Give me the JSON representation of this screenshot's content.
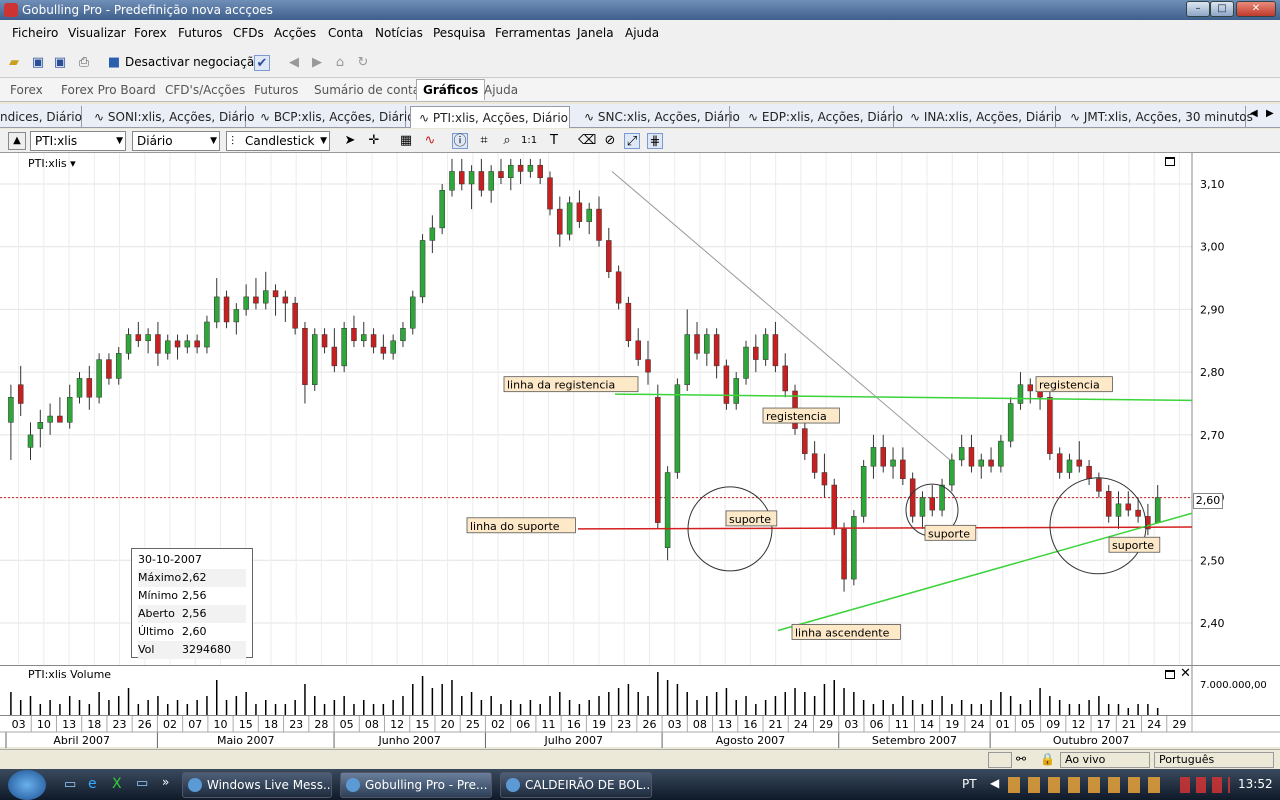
{
  "window": {
    "title": "Gobulling Pro - Predefinição nova accçoes"
  },
  "menu": [
    "Ficheiro",
    "Visualizar",
    "Forex",
    "Futuros",
    "CFDs",
    "Acções",
    "Conta",
    "Notícias",
    "Pesquisa",
    "Ferramentas",
    "Janela",
    "Ajuda"
  ],
  "toolbar": {
    "trading_toggle": "Desactivar negociação"
  },
  "main_tabs": [
    {
      "label": "Forex"
    },
    {
      "label": "Forex Pro Board"
    },
    {
      "label": "CFD's/Acções"
    },
    {
      "label": "Futuros"
    },
    {
      "label": "Sumário de conta"
    },
    {
      "label": "Gráficos",
      "active": true
    },
    {
      "label": "Ajuda"
    }
  ],
  "chart_tabs": [
    {
      "label": "ndices, Diário"
    },
    {
      "label": "SONI:xlis, Acções, Diário"
    },
    {
      "label": "BCP:xlis, Acções, Diário"
    },
    {
      "label": "PTI:xlis, Acções, Diário",
      "active": true
    },
    {
      "label": "SNC:xlis, Acções, Diário"
    },
    {
      "label": "EDP:xlis, Acções, Diário"
    },
    {
      "label": "INA:xlis, Acções, Diário"
    },
    {
      "label": "JMT:xlis, Acções, 30 minutos"
    }
  ],
  "chart_toolbar": {
    "symbol": "PTI:xlis",
    "period": "Diário",
    "style": "Candlestick"
  },
  "chart_data": {
    "type": "candlestick",
    "title": "PTI:xlis",
    "ylim": [
      2.35,
      3.15
    ],
    "y_ticks": [
      "3,10",
      "3,00",
      "2,90",
      "2,80",
      "2,70",
      "2,60",
      "2,50",
      "2,40"
    ],
    "current_price_label": "2,60",
    "candles": [
      {
        "o": 2.72,
        "h": 2.78,
        "l": 2.66,
        "c": 2.76
      },
      {
        "o": 2.78,
        "h": 2.81,
        "l": 2.73,
        "c": 2.75
      },
      {
        "o": 2.68,
        "h": 2.72,
        "l": 2.66,
        "c": 2.7
      },
      {
        "o": 2.71,
        "h": 2.74,
        "l": 2.68,
        "c": 2.72
      },
      {
        "o": 2.72,
        "h": 2.75,
        "l": 2.7,
        "c": 2.73
      },
      {
        "o": 2.73,
        "h": 2.76,
        "l": 2.72,
        "c": 2.72
      },
      {
        "o": 2.72,
        "h": 2.78,
        "l": 2.71,
        "c": 2.76
      },
      {
        "o": 2.76,
        "h": 2.8,
        "l": 2.75,
        "c": 2.79
      },
      {
        "o": 2.79,
        "h": 2.81,
        "l": 2.74,
        "c": 2.76
      },
      {
        "o": 2.76,
        "h": 2.83,
        "l": 2.75,
        "c": 2.82
      },
      {
        "o": 2.82,
        "h": 2.83,
        "l": 2.78,
        "c": 2.79
      },
      {
        "o": 2.79,
        "h": 2.84,
        "l": 2.78,
        "c": 2.83
      },
      {
        "o": 2.83,
        "h": 2.87,
        "l": 2.82,
        "c": 2.86
      },
      {
        "o": 2.86,
        "h": 2.88,
        "l": 2.84,
        "c": 2.85
      },
      {
        "o": 2.85,
        "h": 2.87,
        "l": 2.83,
        "c": 2.86
      },
      {
        "o": 2.86,
        "h": 2.88,
        "l": 2.81,
        "c": 2.83
      },
      {
        "o": 2.83,
        "h": 2.86,
        "l": 2.82,
        "c": 2.85
      },
      {
        "o": 2.85,
        "h": 2.86,
        "l": 2.82,
        "c": 2.84
      },
      {
        "o": 2.84,
        "h": 2.86,
        "l": 2.83,
        "c": 2.85
      },
      {
        "o": 2.85,
        "h": 2.86,
        "l": 2.83,
        "c": 2.84
      },
      {
        "o": 2.84,
        "h": 2.89,
        "l": 2.83,
        "c": 2.88
      },
      {
        "o": 2.88,
        "h": 2.95,
        "l": 2.87,
        "c": 2.92
      },
      {
        "o": 2.92,
        "h": 2.93,
        "l": 2.87,
        "c": 2.88
      },
      {
        "o": 2.88,
        "h": 2.91,
        "l": 2.86,
        "c": 2.9
      },
      {
        "o": 2.9,
        "h": 2.94,
        "l": 2.89,
        "c": 2.92
      },
      {
        "o": 2.92,
        "h": 2.95,
        "l": 2.9,
        "c": 2.91
      },
      {
        "o": 2.91,
        "h": 2.96,
        "l": 2.9,
        "c": 2.93
      },
      {
        "o": 2.93,
        "h": 2.94,
        "l": 2.89,
        "c": 2.92
      },
      {
        "o": 2.92,
        "h": 2.93,
        "l": 2.88,
        "c": 2.91
      },
      {
        "o": 2.91,
        "h": 2.92,
        "l": 2.86,
        "c": 2.87
      },
      {
        "o": 2.87,
        "h": 2.88,
        "l": 2.75,
        "c": 2.78
      },
      {
        "o": 2.78,
        "h": 2.87,
        "l": 2.77,
        "c": 2.86
      },
      {
        "o": 2.86,
        "h": 2.87,
        "l": 2.83,
        "c": 2.84
      },
      {
        "o": 2.84,
        "h": 2.87,
        "l": 2.8,
        "c": 2.81
      },
      {
        "o": 2.81,
        "h": 2.88,
        "l": 2.8,
        "c": 2.87
      },
      {
        "o": 2.87,
        "h": 2.89,
        "l": 2.84,
        "c": 2.85
      },
      {
        "o": 2.85,
        "h": 2.88,
        "l": 2.84,
        "c": 2.86
      },
      {
        "o": 2.86,
        "h": 2.87,
        "l": 2.83,
        "c": 2.84
      },
      {
        "o": 2.84,
        "h": 2.86,
        "l": 2.82,
        "c": 2.83
      },
      {
        "o": 2.83,
        "h": 2.86,
        "l": 2.82,
        "c": 2.85
      },
      {
        "o": 2.85,
        "h": 2.88,
        "l": 2.84,
        "c": 2.87
      },
      {
        "o": 2.87,
        "h": 2.93,
        "l": 2.86,
        "c": 2.92
      },
      {
        "o": 2.92,
        "h": 3.02,
        "l": 2.91,
        "c": 3.01
      },
      {
        "o": 3.01,
        "h": 3.05,
        "l": 2.99,
        "c": 3.03
      },
      {
        "o": 3.03,
        "h": 3.1,
        "l": 3.02,
        "c": 3.09
      },
      {
        "o": 3.09,
        "h": 3.14,
        "l": 3.08,
        "c": 3.12
      },
      {
        "o": 3.12,
        "h": 3.14,
        "l": 3.09,
        "c": 3.1
      },
      {
        "o": 3.1,
        "h": 3.13,
        "l": 3.06,
        "c": 3.12
      },
      {
        "o": 3.12,
        "h": 3.14,
        "l": 3.08,
        "c": 3.09
      },
      {
        "o": 3.09,
        "h": 3.13,
        "l": 3.07,
        "c": 3.12
      },
      {
        "o": 3.12,
        "h": 3.14,
        "l": 3.1,
        "c": 3.11
      },
      {
        "o": 3.11,
        "h": 3.14,
        "l": 3.09,
        "c": 3.13
      },
      {
        "o": 3.13,
        "h": 3.14,
        "l": 3.1,
        "c": 3.12
      },
      {
        "o": 3.12,
        "h": 3.14,
        "l": 3.11,
        "c": 3.13
      },
      {
        "o": 3.13,
        "h": 3.14,
        "l": 3.1,
        "c": 3.11
      },
      {
        "o": 3.11,
        "h": 3.12,
        "l": 3.05,
        "c": 3.06
      },
      {
        "o": 3.06,
        "h": 3.08,
        "l": 3.0,
        "c": 3.02
      },
      {
        "o": 3.02,
        "h": 3.08,
        "l": 3.01,
        "c": 3.07
      },
      {
        "o": 3.07,
        "h": 3.09,
        "l": 3.03,
        "c": 3.04
      },
      {
        "o": 3.04,
        "h": 3.07,
        "l": 3.02,
        "c": 3.06
      },
      {
        "o": 3.06,
        "h": 3.08,
        "l": 3.0,
        "c": 3.01
      },
      {
        "o": 3.01,
        "h": 3.03,
        "l": 2.95,
        "c": 2.96
      },
      {
        "o": 2.96,
        "h": 2.97,
        "l": 2.9,
        "c": 2.91
      },
      {
        "o": 2.91,
        "h": 2.92,
        "l": 2.84,
        "c": 2.85
      },
      {
        "o": 2.85,
        "h": 2.87,
        "l": 2.81,
        "c": 2.82
      },
      {
        "o": 2.82,
        "h": 2.85,
        "l": 2.78,
        "c": 2.8
      },
      {
        "o": 2.76,
        "h": 2.78,
        "l": 2.55,
        "c": 2.56
      },
      {
        "o": 2.52,
        "h": 2.65,
        "l": 2.5,
        "c": 2.64
      },
      {
        "o": 2.64,
        "h": 2.79,
        "l": 2.63,
        "c": 2.78
      },
      {
        "o": 2.78,
        "h": 2.9,
        "l": 2.77,
        "c": 2.86
      },
      {
        "o": 2.86,
        "h": 2.88,
        "l": 2.82,
        "c": 2.83
      },
      {
        "o": 2.83,
        "h": 2.87,
        "l": 2.81,
        "c": 2.86
      },
      {
        "o": 2.86,
        "h": 2.87,
        "l": 2.79,
        "c": 2.81
      },
      {
        "o": 2.81,
        "h": 2.82,
        "l": 2.74,
        "c": 2.75
      },
      {
        "o": 2.75,
        "h": 2.8,
        "l": 2.74,
        "c": 2.79
      },
      {
        "o": 2.79,
        "h": 2.85,
        "l": 2.78,
        "c": 2.84
      },
      {
        "o": 2.84,
        "h": 2.86,
        "l": 2.8,
        "c": 2.82
      },
      {
        "o": 2.82,
        "h": 2.87,
        "l": 2.81,
        "c": 2.86
      },
      {
        "o": 2.86,
        "h": 2.88,
        "l": 2.8,
        "c": 2.81
      },
      {
        "o": 2.81,
        "h": 2.83,
        "l": 2.76,
        "c": 2.77
      },
      {
        "o": 2.77,
        "h": 2.78,
        "l": 2.7,
        "c": 2.71
      },
      {
        "o": 2.71,
        "h": 2.72,
        "l": 2.66,
        "c": 2.67
      },
      {
        "o": 2.67,
        "h": 2.69,
        "l": 2.63,
        "c": 2.64
      },
      {
        "o": 2.64,
        "h": 2.67,
        "l": 2.6,
        "c": 2.62
      },
      {
        "o": 2.62,
        "h": 2.63,
        "l": 2.54,
        "c": 2.55
      },
      {
        "o": 2.55,
        "h": 2.56,
        "l": 2.45,
        "c": 2.47
      },
      {
        "o": 2.47,
        "h": 2.58,
        "l": 2.46,
        "c": 2.57
      },
      {
        "o": 2.57,
        "h": 2.66,
        "l": 2.56,
        "c": 2.65
      },
      {
        "o": 2.65,
        "h": 2.7,
        "l": 2.63,
        "c": 2.68
      },
      {
        "o": 2.68,
        "h": 2.7,
        "l": 2.64,
        "c": 2.65
      },
      {
        "o": 2.65,
        "h": 2.68,
        "l": 2.63,
        "c": 2.66
      },
      {
        "o": 2.66,
        "h": 2.68,
        "l": 2.62,
        "c": 2.63
      },
      {
        "o": 2.63,
        "h": 2.64,
        "l": 2.56,
        "c": 2.57
      },
      {
        "o": 2.57,
        "h": 2.61,
        "l": 2.55,
        "c": 2.6
      },
      {
        "o": 2.6,
        "h": 2.62,
        "l": 2.57,
        "c": 2.58
      },
      {
        "o": 2.58,
        "h": 2.63,
        "l": 2.57,
        "c": 2.62
      },
      {
        "o": 2.62,
        "h": 2.67,
        "l": 2.61,
        "c": 2.66
      },
      {
        "o": 2.66,
        "h": 2.7,
        "l": 2.65,
        "c": 2.68
      },
      {
        "o": 2.68,
        "h": 2.7,
        "l": 2.64,
        "c": 2.65
      },
      {
        "o": 2.65,
        "h": 2.67,
        "l": 2.63,
        "c": 2.66
      },
      {
        "o": 2.66,
        "h": 2.68,
        "l": 2.64,
        "c": 2.65
      },
      {
        "o": 2.65,
        "h": 2.7,
        "l": 2.64,
        "c": 2.69
      },
      {
        "o": 2.69,
        "h": 2.76,
        "l": 2.68,
        "c": 2.75
      },
      {
        "o": 2.75,
        "h": 2.8,
        "l": 2.74,
        "c": 2.78
      },
      {
        "o": 2.78,
        "h": 2.79,
        "l": 2.75,
        "c": 2.77
      },
      {
        "o": 2.77,
        "h": 2.79,
        "l": 2.74,
        "c": 2.76
      },
      {
        "o": 2.76,
        "h": 2.77,
        "l": 2.66,
        "c": 2.67
      },
      {
        "o": 2.67,
        "h": 2.68,
        "l": 2.63,
        "c": 2.64
      },
      {
        "o": 2.64,
        "h": 2.67,
        "l": 2.63,
        "c": 2.66
      },
      {
        "o": 2.66,
        "h": 2.69,
        "l": 2.64,
        "c": 2.65
      },
      {
        "o": 2.65,
        "h": 2.66,
        "l": 2.62,
        "c": 2.63
      },
      {
        "o": 2.63,
        "h": 2.64,
        "l": 2.6,
        "c": 2.61
      },
      {
        "o": 2.61,
        "h": 2.62,
        "l": 2.56,
        "c": 2.57
      },
      {
        "o": 2.57,
        "h": 2.61,
        "l": 2.55,
        "c": 2.59
      },
      {
        "o": 2.59,
        "h": 2.61,
        "l": 2.57,
        "c": 2.58
      },
      {
        "o": 2.58,
        "h": 2.6,
        "l": 2.56,
        "c": 2.57
      },
      {
        "o": 2.57,
        "h": 2.59,
        "l": 2.54,
        "c": 2.55
      },
      {
        "o": 2.56,
        "h": 2.62,
        "l": 2.56,
        "c": 2.6
      }
    ],
    "volumes": [
      0.6,
      0.4,
      0.5,
      0.3,
      0.4,
      0.3,
      0.5,
      0.4,
      0.3,
      0.6,
      0.4,
      0.5,
      0.7,
      0.3,
      0.4,
      0.5,
      0.3,
      0.4,
      0.3,
      0.4,
      0.5,
      0.9,
      0.4,
      0.5,
      0.6,
      0.3,
      0.4,
      0.3,
      0.3,
      0.4,
      0.8,
      0.5,
      0.3,
      0.4,
      0.5,
      0.3,
      0.4,
      0.3,
      0.3,
      0.4,
      0.5,
      0.8,
      1.0,
      0.7,
      0.8,
      0.9,
      0.5,
      0.6,
      0.4,
      0.5,
      0.3,
      0.4,
      0.3,
      0.4,
      0.3,
      0.5,
      0.6,
      0.4,
      0.3,
      0.4,
      0.5,
      0.6,
      0.7,
      0.8,
      0.6,
      0.5,
      1.1,
      0.9,
      0.8,
      0.6,
      0.4,
      0.5,
      0.6,
      0.7,
      0.4,
      0.5,
      0.3,
      0.4,
      0.5,
      0.6,
      0.7,
      0.6,
      0.5,
      0.8,
      0.9,
      0.7,
      0.6,
      0.4,
      0.3,
      0.4,
      0.3,
      0.5,
      0.4,
      0.3,
      0.4,
      0.5,
      0.3,
      0.4,
      0.3,
      0.3,
      0.4,
      0.6,
      0.5,
      0.3,
      0.4,
      0.7,
      0.5,
      0.4,
      0.3,
      0.3,
      0.4,
      0.5,
      0.3,
      0.3,
      0.2,
      0.3,
      0.3,
      0.2
    ],
    "volume_tick": "7.000.000,00",
    "volume_title": "PTI:xlis Volume",
    "day_ticks": [
      "03",
      "10",
      "13",
      "18",
      "23",
      "26",
      "02",
      "07",
      "10",
      "15",
      "18",
      "23",
      "28",
      "05",
      "08",
      "12",
      "15",
      "20",
      "25",
      "02",
      "06",
      "11",
      "16",
      "19",
      "23",
      "26",
      "03",
      "08",
      "13",
      "16",
      "21",
      "24",
      "29",
      "03",
      "06",
      "11",
      "14",
      "19",
      "24",
      "01",
      "05",
      "09",
      "12",
      "17",
      "21",
      "24",
      "29"
    ],
    "month_ticks": [
      "Abril 2007",
      "Maio 2007",
      "Junho 2007",
      "Julho 2007",
      "Agosto 2007",
      "Setembro 2007",
      "Outubro 2007"
    ],
    "annotations": {
      "resistance_line_label": "linha da registencia",
      "support_line_label": "linha do suporte",
      "ascending_line_label": "linha ascendente",
      "labels": [
        "suporte",
        "registencia",
        "suporte",
        "registencia",
        "suporte"
      ]
    },
    "colors": {
      "up": "#2fa63a",
      "down": "#c62020",
      "resistance": "#3ad43a",
      "support": "#d42020",
      "ascending": "#3ad43a",
      "label_bg": "#fde8c8"
    }
  },
  "info_box": {
    "date": "30-10-2007",
    "rows": [
      {
        "k": "Máximo",
        "v": "2,62"
      },
      {
        "k": "Mínimo",
        "v": "2,56"
      },
      {
        "k": "Aberto",
        "v": "2,56"
      },
      {
        "k": "Último",
        "v": "2,60"
      },
      {
        "k": "Vol",
        "v": "3294680"
      }
    ]
  },
  "statusbar": {
    "live": "Ao vivo",
    "language": "Português"
  },
  "taskbar": {
    "items": [
      {
        "label": "Windows Live Mess..."
      },
      {
        "label": "Gobulling Pro - Pre..."
      },
      {
        "label": "CALDEIRÃO DE BOL..."
      }
    ],
    "lang": "PT",
    "time": "13:52"
  }
}
